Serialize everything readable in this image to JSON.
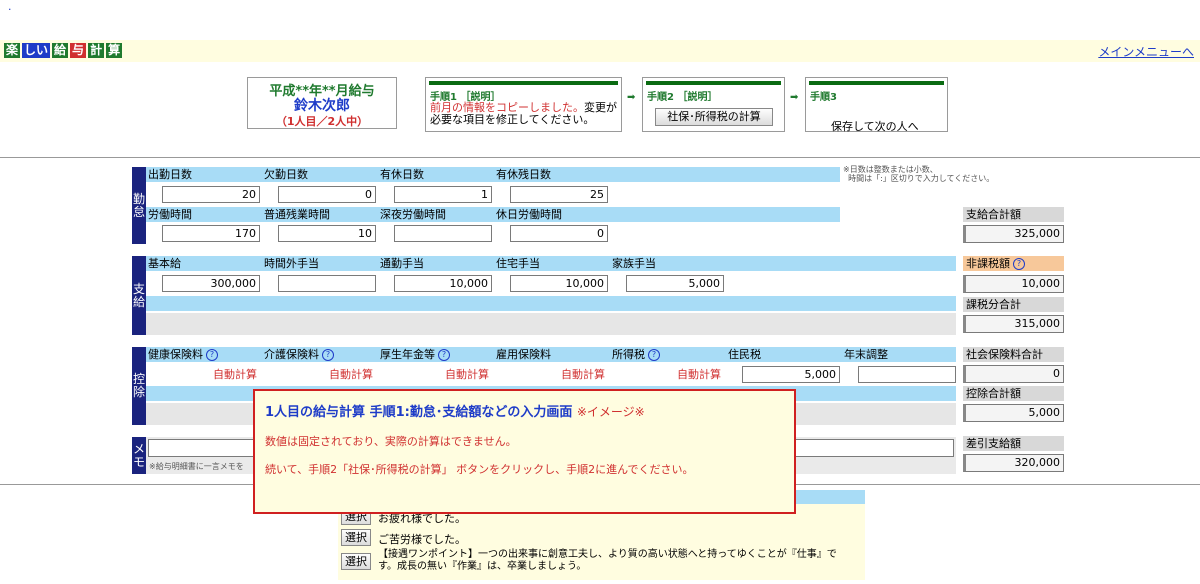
{
  "app": {
    "logo_parts": [
      "楽",
      "しい",
      "給",
      "与",
      "計",
      "算"
    ],
    "menu_link": "メインメニューへ"
  },
  "header": {
    "month_title": "平成**年**月給与",
    "employee_name": "鈴木次郎",
    "progress": "（1人目／2人中）",
    "step1": {
      "title": "手順1 ［説明］",
      "desc_red": "前月の情報をコピーしました。",
      "desc_rest": "変更が",
      "desc_line2": "必要な項目を修正してください。"
    },
    "step2": {
      "title": "手順2 ［説明］",
      "button": "社保･所得税の計算"
    },
    "step3": {
      "title": "手順3",
      "desc": "保存して次の人へ"
    }
  },
  "attendance": {
    "section_label": "勤怠",
    "note1": "※日数は整数または小数、",
    "note2": "時間は「:」区切りで入力してください。",
    "row1_labels": [
      "出勤日数",
      "欠勤日数",
      "有休日数",
      "有休残日数"
    ],
    "row1_values": [
      "20",
      "0",
      "1",
      "25"
    ],
    "row2_labels": [
      "労働時間",
      "普通残業時間",
      "深夜労働時間",
      "休日労働時間"
    ],
    "row2_values": [
      "170",
      "10",
      "",
      "0"
    ]
  },
  "pay": {
    "section_label": "支給",
    "labels": [
      "基本給",
      "時間外手当",
      "通勤手当",
      "住宅手当",
      "家族手当"
    ],
    "values": [
      "300,000",
      "",
      "10,000",
      "10,000",
      "5,000"
    ]
  },
  "deduct": {
    "section_label": "控除",
    "labels": [
      "健康保険料",
      "介護保険料",
      "厚生年金等",
      "雇用保険料",
      "所得税",
      "住民税",
      "年末調整"
    ],
    "auto_text": "自動計算",
    "values": [
      "",
      "",
      "",
      "",
      "",
      "5,000",
      ""
    ]
  },
  "memo": {
    "section_label": "メモ",
    "note": "※給与明細書に一言メモを"
  },
  "totals": {
    "total_pay_label": "支給合計額",
    "total_pay": "325,000",
    "nontax_label": "非課税額",
    "nontax": "10,000",
    "taxable_label": "課税分合計",
    "taxable": "315,000",
    "social_label": "社会保険料合計",
    "social": "0",
    "deduct_label": "控除合計額",
    "deduct": "5,000",
    "net_label": "差引支給額",
    "net": "320,000"
  },
  "popup": {
    "heading": "1人目の給与計算 手順1:勤怠･支給額などの入力画面",
    "image_note": "※イメージ※",
    "line1": "数値は固定されており、実際の計算はできません。",
    "line2": "続いて、手順2「社保･所得税の計算」 ボタンをクリックし、手順2に進んでください。"
  },
  "memo_phrases": {
    "button_label": "選択",
    "items": [
      "お疲れ様でした。",
      "ご苦労様でした。",
      "【接遇ワンポイント】一つの出来事に創意工夫し、より質の高い状態へと持ってゆくことが『仕事』で",
      "す。成長の無い『作業』は、卒業しましょう。"
    ]
  },
  "colors": {
    "label_bg": "#a8dcf6",
    "section_bg": "#1a237e",
    "popup_border": "#d02020",
    "auto_text": "#d03030"
  }
}
